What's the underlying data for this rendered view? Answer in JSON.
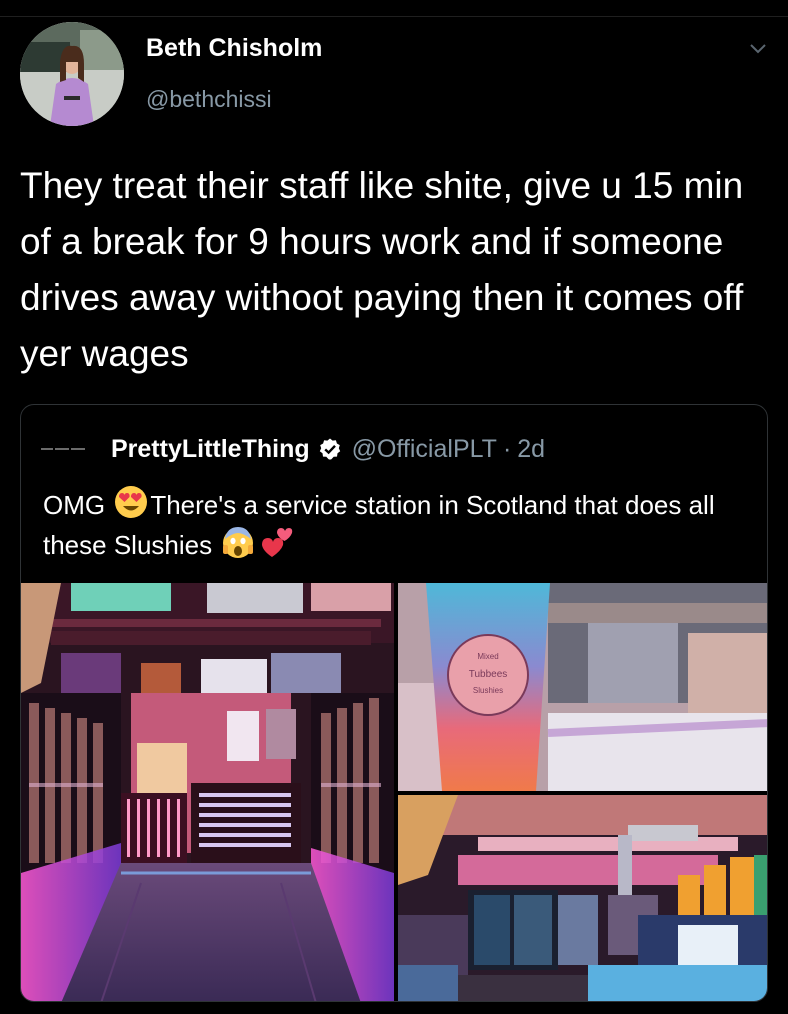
{
  "tweet": {
    "author_name": "Beth Chisholm",
    "author_handle": "@bethchissi",
    "text": "They treat their staff like shite, give u 15 min of a break for 9 hours work and if someone drives away withoot paying then it comes off yer wages"
  },
  "quoted_tweet": {
    "author_name": "PrettyLittleThing",
    "author_handle": "@OfficialPLT",
    "separator": "·",
    "time": "2d",
    "text_part1": "OMG",
    "text_part2": "There's a service station in Scotland that does all these Slushies",
    "photo_cup_label": [
      "Mixed",
      "Tubbees",
      "Slushies"
    ]
  },
  "icons": {
    "menu": "chevron-down-icon",
    "verified": "verified-badge-icon",
    "emoji1": "heart-eyes-emoji",
    "emoji2": "scream-emoji",
    "emoji3": "two-hearts-emoji"
  },
  "colors": {
    "background": "#000000",
    "secondary_text": "#8899a6",
    "border": "#2f3336"
  }
}
